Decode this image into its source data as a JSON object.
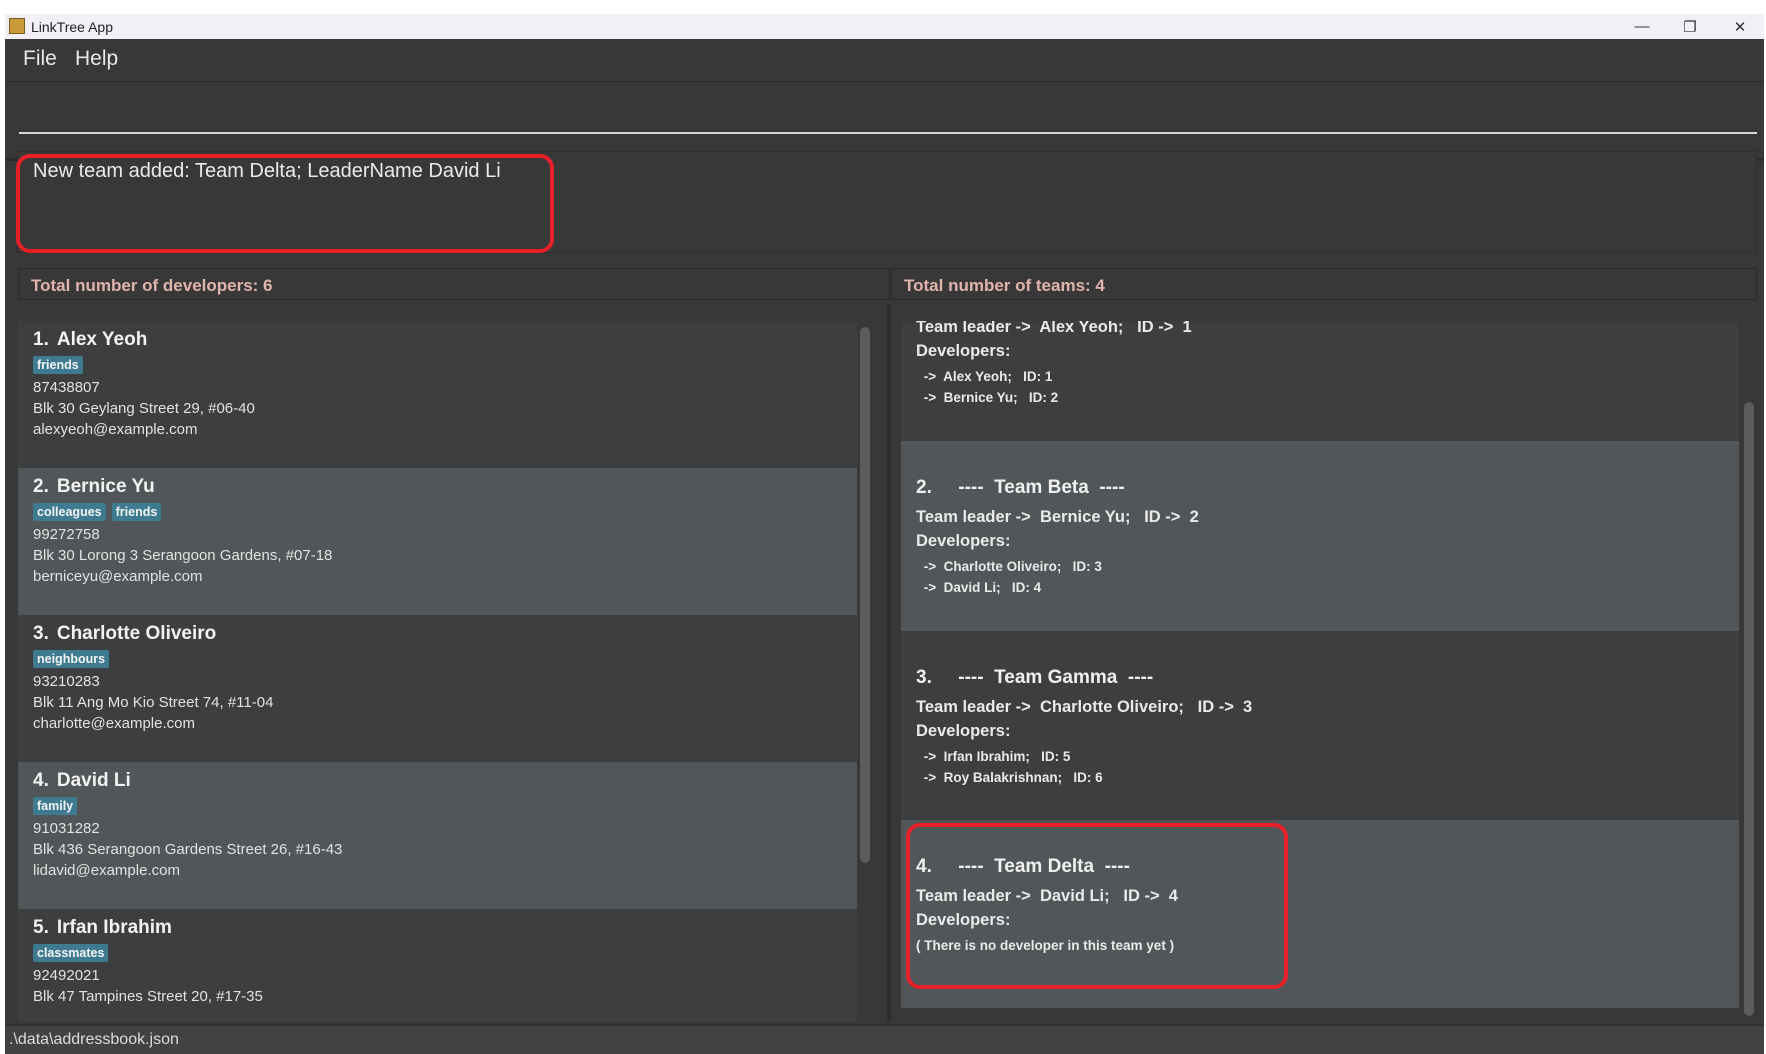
{
  "window": {
    "title": "LinkTree App",
    "icon": "app-icon"
  },
  "menu": [
    "File",
    "Help"
  ],
  "command": {
    "value": "",
    "placeholder": ""
  },
  "result": "New team added: Team Delta; LeaderName David Li",
  "developers_header": "Total number of developers: 6",
  "teams_header": "Total number of teams: 4",
  "developers": [
    {
      "index": "1.",
      "name": "Alex Yeoh",
      "tags": [
        "friends"
      ],
      "phone": "87438807",
      "address": "Blk 30 Geylang Street 29, #06-40",
      "email": "alexyeoh@example.com"
    },
    {
      "index": "2.",
      "name": "Bernice Yu",
      "tags": [
        "colleagues",
        "friends"
      ],
      "phone": "99272758",
      "address": "Blk 30 Lorong 3 Serangoon Gardens, #07-18",
      "email": "berniceyu@example.com"
    },
    {
      "index": "3.",
      "name": "Charlotte Oliveiro",
      "tags": [
        "neighbours"
      ],
      "phone": "93210283",
      "address": "Blk 11 Ang Mo Kio Street 74, #11-04",
      "email": "charlotte@example.com"
    },
    {
      "index": "4.",
      "name": "David Li",
      "tags": [
        "family"
      ],
      "phone": "91031282",
      "address": "Blk 436 Serangoon Gardens Street 26, #16-43",
      "email": "lidavid@example.com"
    },
    {
      "index": "5.",
      "name": "Irfan Ibrahim",
      "tags": [
        "classmates"
      ],
      "phone": "92492021",
      "address": "Blk 47 Tampines Street 20, #17-35",
      "email": ""
    }
  ],
  "teams": [
    {
      "title": "",
      "leader": "Team leader ->  Alex Yeoh;   ID ->  1",
      "developers_label": "Developers:",
      "devs": [
        " ->  Alex Yeoh;   ID: 1",
        " ->  Bernice Yu;   ID: 2"
      ]
    },
    {
      "title": "2.     ----  Team Beta  ----",
      "leader": "Team leader ->  Bernice Yu;   ID ->  2",
      "developers_label": "Developers:",
      "devs": [
        " ->  Charlotte Oliveiro;   ID: 3",
        " ->  David Li;   ID: 4"
      ]
    },
    {
      "title": "3.     ----  Team Gamma  ----",
      "leader": "Team leader ->  Charlotte Oliveiro;   ID ->  3",
      "developers_label": "Developers:",
      "devs": [
        " ->  Irfan Ibrahim;   ID: 5",
        " ->  Roy Balakrishnan;   ID: 6"
      ]
    },
    {
      "title": "4.     ----  Team Delta  ----",
      "leader": "Team leader ->  David Li;   ID ->  4",
      "developers_label": "Developers:",
      "devs": [
        "( There is no developer in this team yet )"
      ]
    }
  ],
  "status": ".\\data\\addressbook.json",
  "colors": {
    "tag": "#3e7b91",
    "header_text": "#e0b4ac",
    "highlight": "#e8202a"
  }
}
